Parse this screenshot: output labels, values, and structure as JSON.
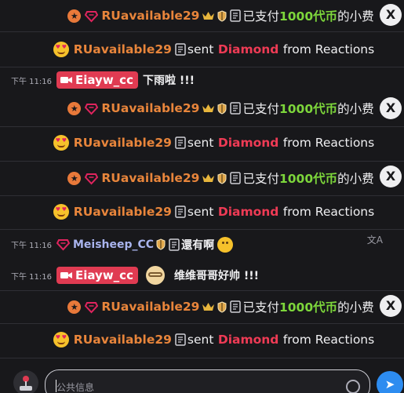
{
  "colors": {
    "background": "#18181b",
    "username_orange": "#e8853b",
    "username_lavender": "#a9b4ee",
    "highlight_green": "#7dd63b",
    "highlight_red": "#ef3b55",
    "cam_badge": "#e03b52",
    "send_button": "#2d8cf0"
  },
  "tip_event": {
    "user": "RUavailable29",
    "paid": "已支付",
    "amount": "1000代币",
    "suffix": "的小费",
    "close_label": "X"
  },
  "gift_event": {
    "user": "RUavailable29",
    "sent": "sent",
    "gift": "Diamond",
    "suffix": "from Reactions"
  },
  "chat": [
    {
      "time": "下午 11:16",
      "user": "Eiayw_cc",
      "text": "下雨啦 !!!"
    },
    {
      "time": "下午 11:16",
      "user": "Meisheep_CC",
      "text": "還有啊"
    },
    {
      "time": "下午 11:16",
      "user": "Eiayw_cc",
      "text": "维维哥哥好帅 !!!"
    }
  ],
  "translate_icon": "translate-icon",
  "composer": {
    "placeholder": "公共信息",
    "emoji_icon": "smile-icon",
    "send_icon": "send-arrow-icon",
    "left_icon": "joystick-icon"
  }
}
